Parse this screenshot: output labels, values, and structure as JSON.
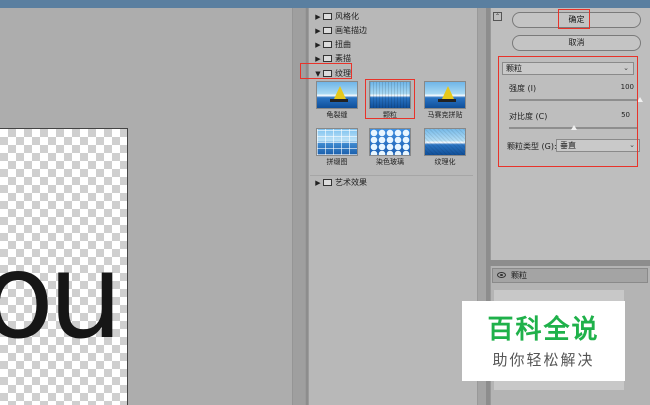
{
  "filter_gallery": {
    "categories_top": [
      {
        "label": "风格化",
        "expanded": false
      },
      {
        "label": "画笔描边",
        "expanded": false
      },
      {
        "label": "扭曲",
        "expanded": false
      },
      {
        "label": "素描",
        "expanded": false
      }
    ],
    "texture_category": {
      "label": "纹理",
      "expanded": true
    },
    "thumbnails": [
      {
        "label": "龟裂缝"
      },
      {
        "label": "颗粒",
        "selected": true
      },
      {
        "label": "马赛克拼贴"
      },
      {
        "label": "拼缀图"
      },
      {
        "label": "染色玻璃"
      },
      {
        "label": "纹理化"
      }
    ],
    "categories_bottom": [
      {
        "label": "艺术效果",
        "expanded": false
      }
    ]
  },
  "settings": {
    "ok_label": "确定",
    "cancel_label": "取消",
    "filter_select": "颗粒",
    "intensity": {
      "label": "强度 (I)",
      "value": "100",
      "level": 1.0
    },
    "contrast": {
      "label": "对比度 (C)",
      "value": "50",
      "level": 0.5
    },
    "grain_type": {
      "label": "颗粒类型 (G):",
      "value": "垂直"
    }
  },
  "layers": {
    "effect_layer": "颗粒"
  },
  "watermark": {
    "title": "百科全说",
    "subtitle": "助你轻松解决"
  },
  "colors": {
    "highlight_red": "#e8332a",
    "watermark_green": "#1fb14a"
  }
}
